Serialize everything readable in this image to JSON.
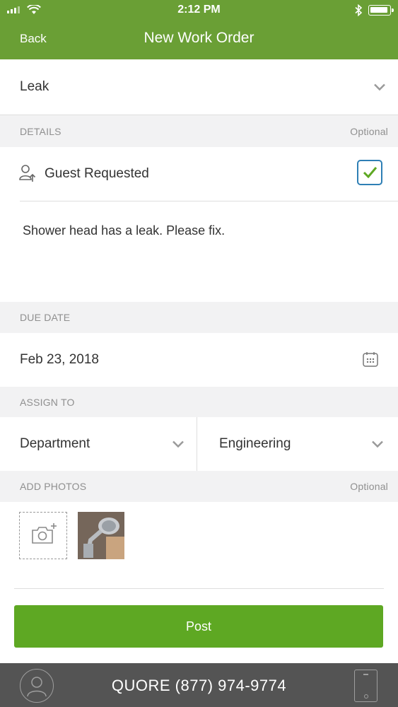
{
  "status_bar": {
    "time": "2:12 PM"
  },
  "nav": {
    "back_label": "Back",
    "title": "New Work Order"
  },
  "category": {
    "value": "Leak"
  },
  "details": {
    "header": "DETAILS",
    "optional": "Optional",
    "guest_requested_label": "Guest Requested",
    "guest_requested_checked": true,
    "description": "Shower head has a leak. Please fix."
  },
  "due_date": {
    "header": "DUE DATE",
    "value": "Feb 23, 2018"
  },
  "assign_to": {
    "header": "ASSIGN TO",
    "type": "Department",
    "target": "Engineering"
  },
  "photos": {
    "header": "ADD PHOTOS",
    "optional": "Optional"
  },
  "post_label": "Post",
  "footer": {
    "contact": "QUORE (877) 974-9774"
  },
  "colors": {
    "header_green": "#6a9f35",
    "button_green": "#5ea823",
    "checkbox_blue": "#2e7fb5",
    "footer_gray": "#545454"
  }
}
